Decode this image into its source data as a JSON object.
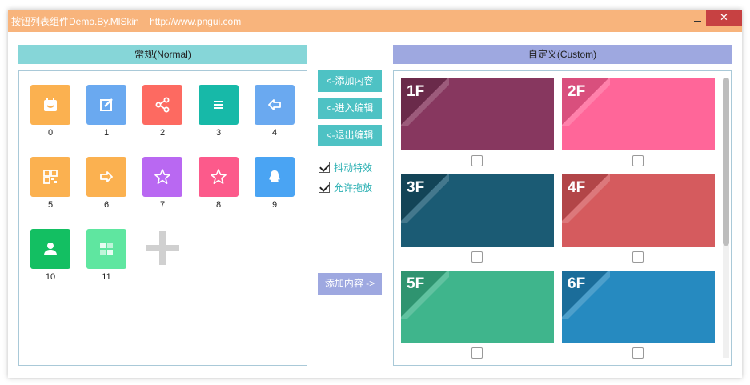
{
  "window": {
    "title": "按钮列表组件Demo.By.MlSkin    http://www.pngui.com",
    "minimize_glyph": "",
    "close_glyph": "✕"
  },
  "normal_panel": {
    "header": "常规(Normal)",
    "tiles": [
      {
        "label": "0",
        "icon": "calendar-icon",
        "color": "#fbb150"
      },
      {
        "label": "1",
        "icon": "edit-icon",
        "color": "#6aa9f0"
      },
      {
        "label": "2",
        "icon": "share-icon",
        "color": "#fd6a61"
      },
      {
        "label": "3",
        "icon": "menu-icon",
        "color": "#17b9a8"
      },
      {
        "label": "4",
        "icon": "back-arrow-icon",
        "color": "#6aa9f0"
      },
      {
        "label": "5",
        "icon": "qrcode-icon",
        "color": "#fbb150"
      },
      {
        "label": "6",
        "icon": "forward-arrow-icon",
        "color": "#fbb150"
      },
      {
        "label": "7",
        "icon": "star-icon",
        "color": "#b968f2"
      },
      {
        "label": "8",
        "icon": "star-icon",
        "color": "#fc5a8b"
      },
      {
        "label": "9",
        "icon": "qq-icon",
        "color": "#4aa4f3"
      },
      {
        "label": "10",
        "icon": "contact-icon",
        "color": "#13bf62"
      },
      {
        "label": "11",
        "icon": "windows-icon",
        "color": "#5fe6a0"
      }
    ],
    "add_icon": "plus-icon"
  },
  "actions": {
    "add_content_left": "<-添加内容",
    "enter_edit": "<-进入编辑",
    "exit_edit": "<-退出编辑",
    "shake_effect": "抖动特效",
    "shake_effect_checked": true,
    "allow_drag": "允许拖放",
    "allow_drag_checked": true,
    "add_content_right": "添加内容 ->"
  },
  "custom_panel": {
    "header": "自定义(Custom)",
    "cards": [
      {
        "label": "1F",
        "color": "#87375f",
        "fold": "#6a2a4a",
        "checked": false
      },
      {
        "label": "2F",
        "color": "#ff6699",
        "fold": "#d94f7d",
        "checked": false
      },
      {
        "label": "3F",
        "color": "#1b5b74",
        "fold": "#134457",
        "checked": false
      },
      {
        "label": "4F",
        "color": "#d55b5e",
        "fold": "#b24548",
        "checked": false
      },
      {
        "label": "5F",
        "color": "#3fb58c",
        "fold": "#2f9470",
        "checked": false
      },
      {
        "label": "6F",
        "color": "#268ac0",
        "fold": "#1b6d9a",
        "checked": false
      }
    ]
  },
  "colors": {
    "titlebar": "#f8b47c",
    "close_button": "#c74142",
    "normal_header": "#86d6d8",
    "custom_header": "#9ea8e0",
    "action_button": "#4ec2c4",
    "action_button_alt": "#9ea8e0"
  }
}
